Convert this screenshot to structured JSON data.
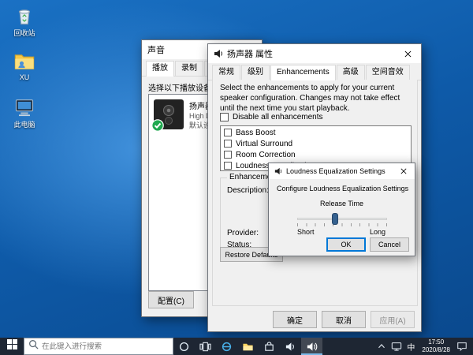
{
  "colors": {
    "accent": "#0078d7",
    "taskbar": "#1e2633"
  },
  "desktop": {
    "icons": [
      {
        "label": "回收站"
      },
      {
        "label": "XU"
      },
      {
        "label": "此电脑"
      }
    ]
  },
  "sound_window": {
    "title": "声音",
    "tabs": [
      "播放",
      "录制",
      "声音"
    ],
    "instruction": "选择以下播放设备来修",
    "device": {
      "name": "扬声器",
      "desc": "High Defi...",
      "status": "默认设备"
    },
    "configure_label": "配置(C)"
  },
  "properties_window": {
    "title": "扬声器 属性",
    "tabs": [
      "常规",
      "级别",
      "Enhancements",
      "高级",
      "空间音效"
    ],
    "intro": "Select the enhancements to apply for your current speaker configuration. Changes may not take effect until the next time you start playback.",
    "disable_all_label": "Disable all enhancements",
    "enhancements": [
      "Bass Boost",
      "Virtual Surround",
      "Room Correction",
      "Loudness Equalization"
    ],
    "group_title": "Enhancement Properties",
    "description_label": "Description:",
    "provider_label": "Provider:",
    "status_label": "Status:",
    "restore_defaults_label": "Restore Defaults",
    "ok_label": "确定",
    "cancel_label": "取消",
    "apply_label": "应用(A)"
  },
  "loudness_dialog": {
    "title": "Loudness Equalization Settings",
    "configure_text": "Configure Loudness Equalization Settings",
    "release_time_label": "Release Time",
    "short_label": "Short",
    "long_label": "Long",
    "ok_label": "OK",
    "cancel_label": "Cancel"
  },
  "taskbar": {
    "search_placeholder": "在此键入进行搜索",
    "tray": {
      "ime": "中",
      "time": "17:50",
      "date": "2020/8/28"
    }
  }
}
